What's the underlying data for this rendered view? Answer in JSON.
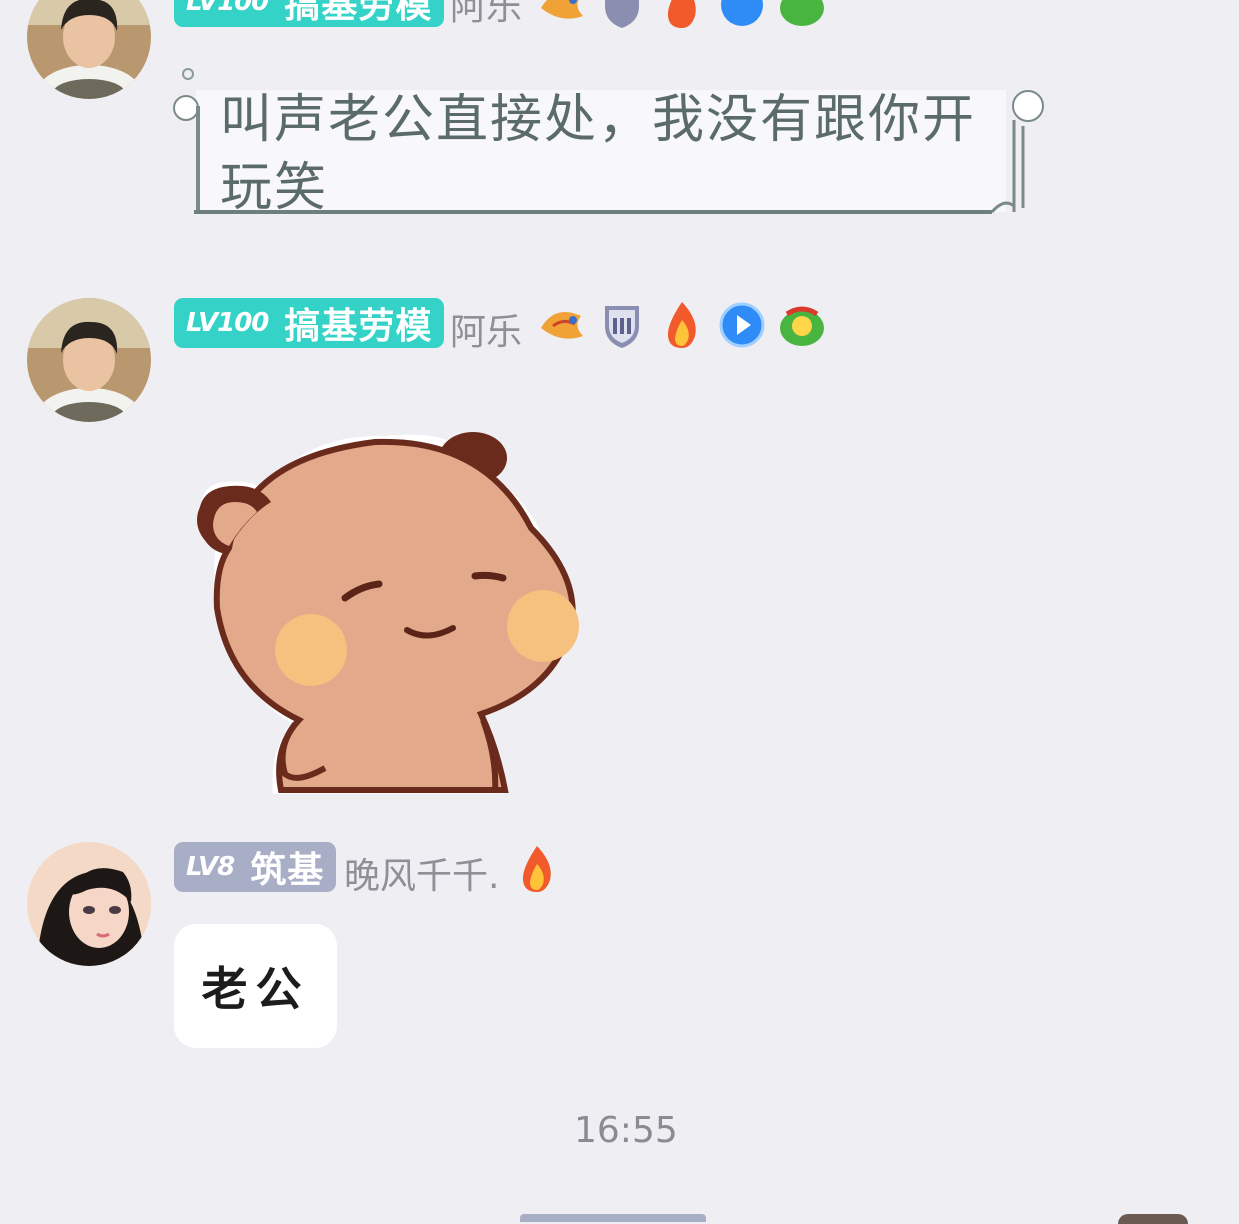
{
  "messages": [
    {
      "level": "LV100",
      "rank": "搞基劳模",
      "sender": "阿乐",
      "text": "叫声老公直接处，我没有跟你开玩笑",
      "text_line1": "叫声老公直接处，我没有跟你开",
      "text_line2": "玩笑"
    },
    {
      "level": "LV100",
      "rank": "搞基劳模",
      "sender": "阿乐",
      "sticker": "bear-smug-sticker"
    },
    {
      "level": "LV8",
      "rank": "筑基",
      "sender": "晚风千千.",
      "text": "老公"
    }
  ],
  "timestamp": "16:55",
  "colors": {
    "background": "#efeef3",
    "teal_badge": "#35d3c7",
    "gray_badge": "#a9aec7",
    "bubble": "#ffffff"
  },
  "icons": [
    "dragon-medal-icon",
    "shield-medal-icon",
    "fire-icon",
    "play-icon",
    "pea-medal-icon"
  ]
}
